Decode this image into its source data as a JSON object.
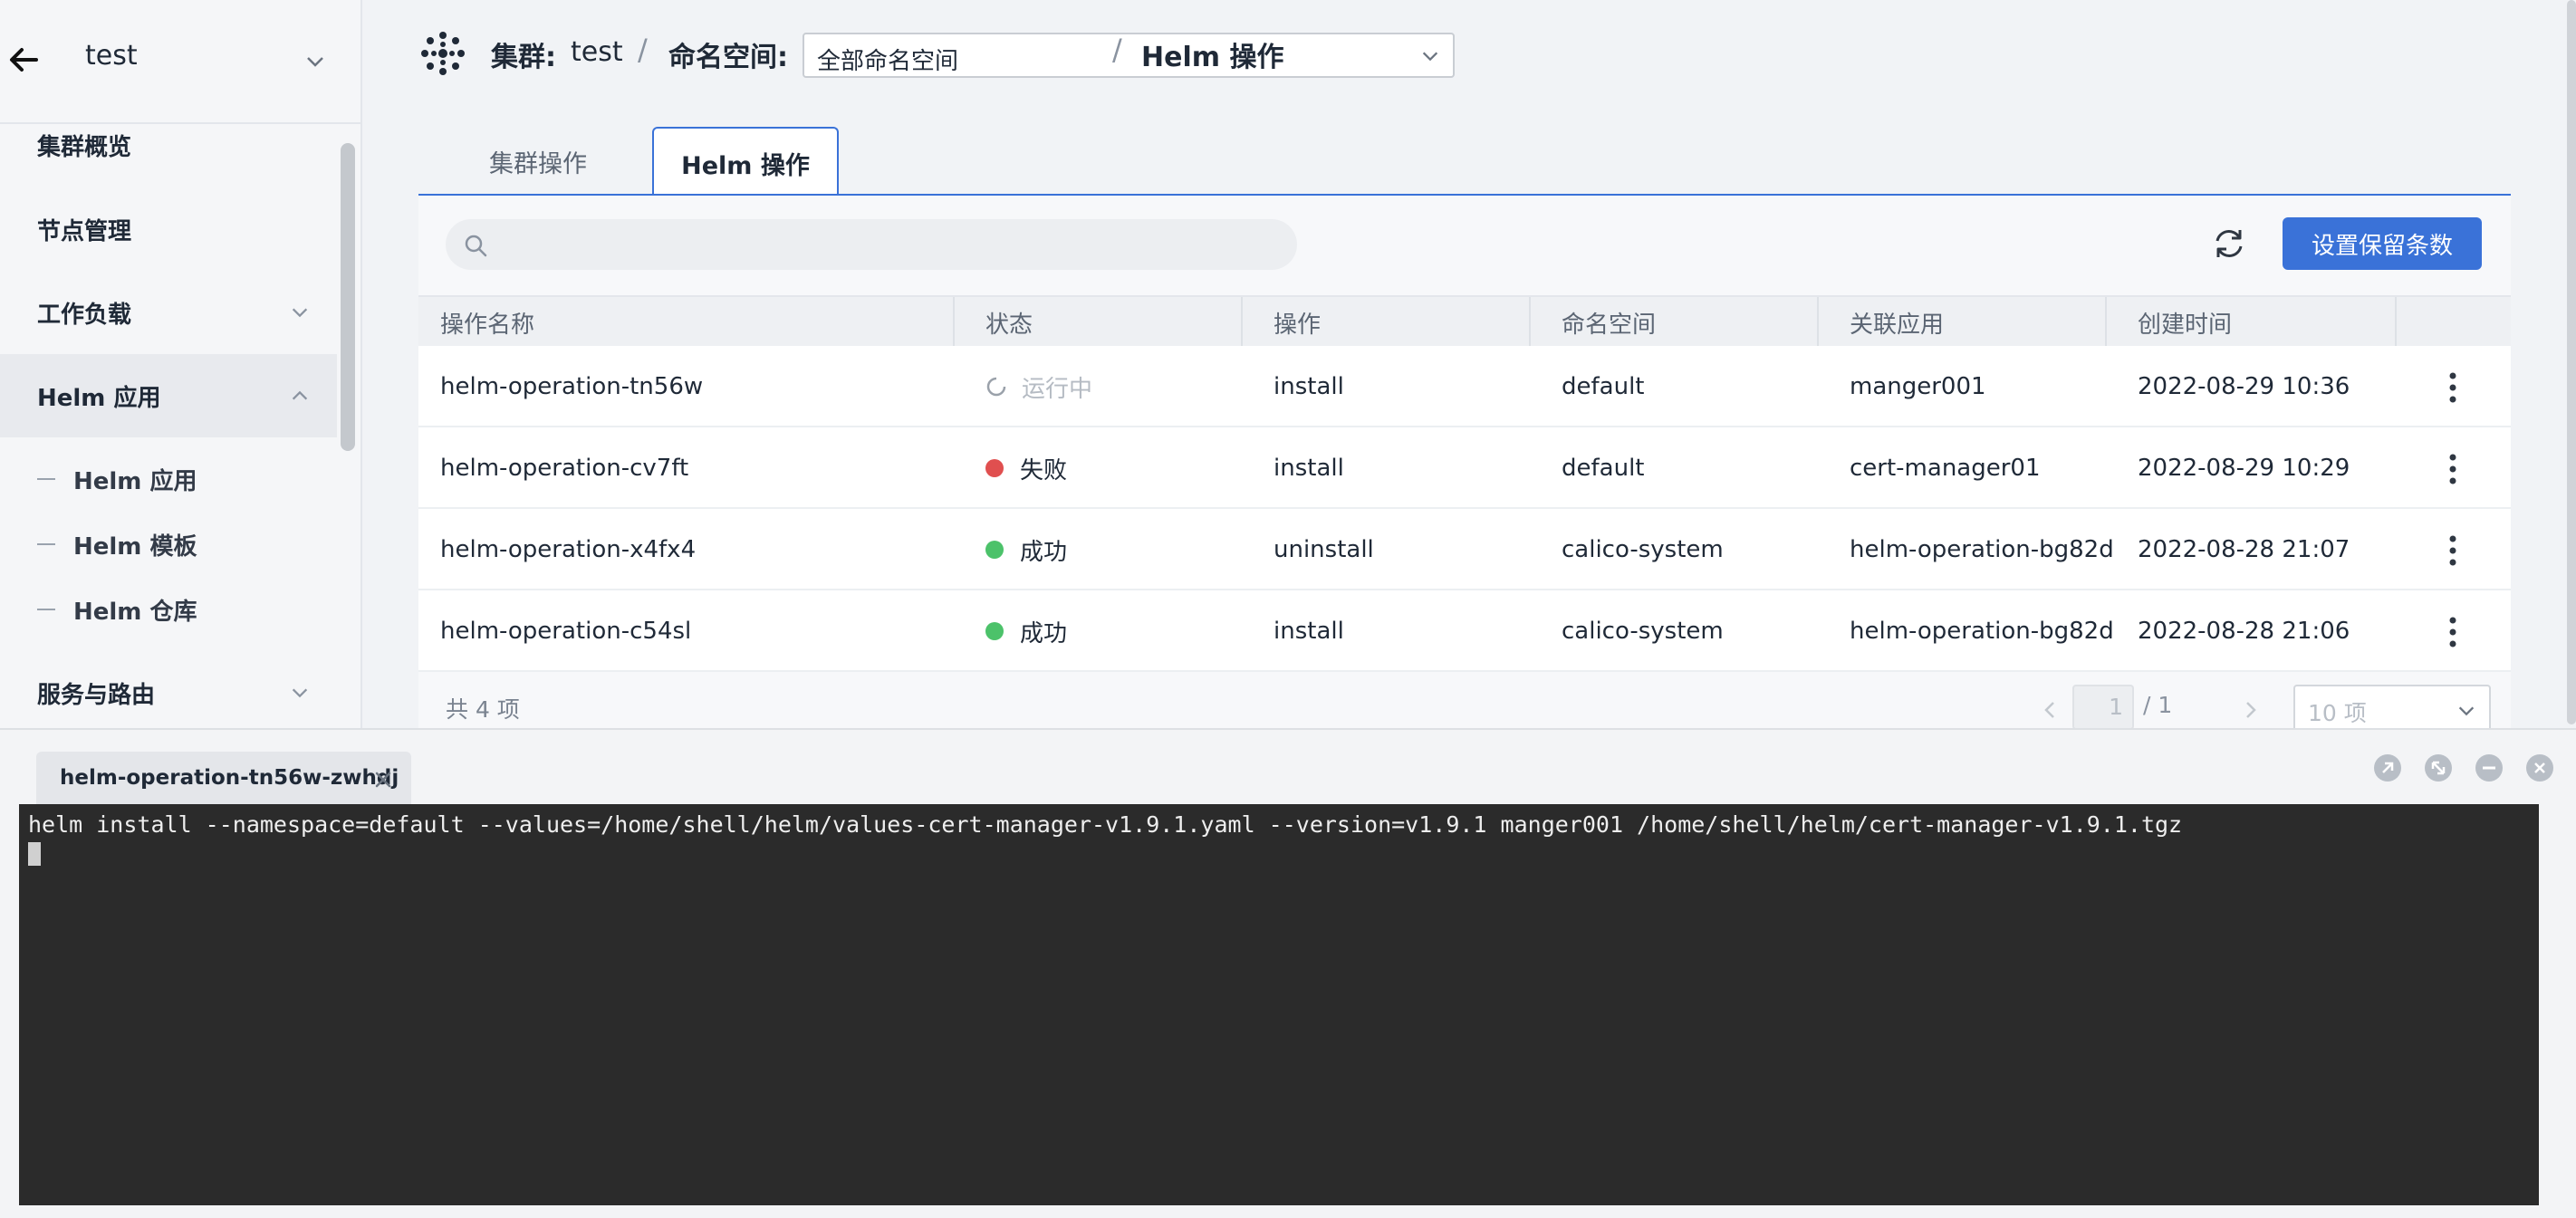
{
  "sidebar": {
    "cluster_name": "test",
    "items": [
      {
        "label": "集群概览"
      },
      {
        "label": "节点管理"
      },
      {
        "label": "工作负载"
      },
      {
        "label": "Helm 应用"
      },
      {
        "label": "服务与路由"
      }
    ],
    "helm_sub_items": [
      {
        "label": "Helm 应用"
      },
      {
        "label": "Helm 模板"
      },
      {
        "label": "Helm 仓库"
      }
    ]
  },
  "header": {
    "cluster_label": "集群:",
    "cluster_value": "test",
    "separator": "/",
    "namespace_label": "命名空间:",
    "namespace_value": "全部命名空间",
    "current_page": "Helm 操作"
  },
  "tabs": [
    {
      "label": "集群操作",
      "active": false
    },
    {
      "label": "Helm 操作",
      "active": true
    }
  ],
  "toolbar": {
    "search_placeholder": "",
    "retain_button_label": "设置保留条数"
  },
  "table": {
    "columns": [
      "操作名称",
      "状态",
      "操作",
      "命名空间",
      "关联应用",
      "创建时间"
    ],
    "rows": [
      {
        "name": "helm-operation-tn56w",
        "status": "运行中",
        "status_type": "running",
        "action": "install",
        "namespace": "default",
        "app": "manger001",
        "created": "2022-08-29 10:36"
      },
      {
        "name": "helm-operation-cv7ft",
        "status": "失败",
        "status_type": "failed",
        "action": "install",
        "namespace": "default",
        "app": "cert-manager01",
        "created": "2022-08-29 10:29"
      },
      {
        "name": "helm-operation-x4fx4",
        "status": "成功",
        "status_type": "success",
        "action": "uninstall",
        "namespace": "calico-system",
        "app": "helm-operation-bg82d",
        "created": "2022-08-28 21:07"
      },
      {
        "name": "helm-operation-c54sl",
        "status": "成功",
        "status_type": "success",
        "action": "install",
        "namespace": "calico-system",
        "app": "helm-operation-bg82d",
        "created": "2022-08-28 21:06"
      }
    ]
  },
  "pagination": {
    "total_text": "共 4 项",
    "current_page": "1",
    "total_pages": "/ 1",
    "page_size": "10 项"
  },
  "terminal": {
    "tab_label": "helm-operation-tn56w-zwhdj",
    "command": "helm install --namespace=default --values=/home/shell/helm/values-cert-manager-v1.9.1.yaml --version=v1.9.1 manger001 /home/shell/helm/cert-manager-v1.9.1.tgz"
  },
  "colors": {
    "accent": "#3a72d8",
    "status_running": "#b5bbc3",
    "status_failed": "#e04f4f",
    "status_success": "#4cc26a",
    "terminal_bg": "#2b2b2b"
  },
  "icons": [
    "back-arrow-icon",
    "chevron-down-icon",
    "chevron-up-icon",
    "cluster-logo-icon",
    "search-icon",
    "refresh-icon",
    "more-vertical-icon",
    "close-icon",
    "popout-icon",
    "expand-icon",
    "minimize-icon",
    "close-circle-icon"
  ]
}
